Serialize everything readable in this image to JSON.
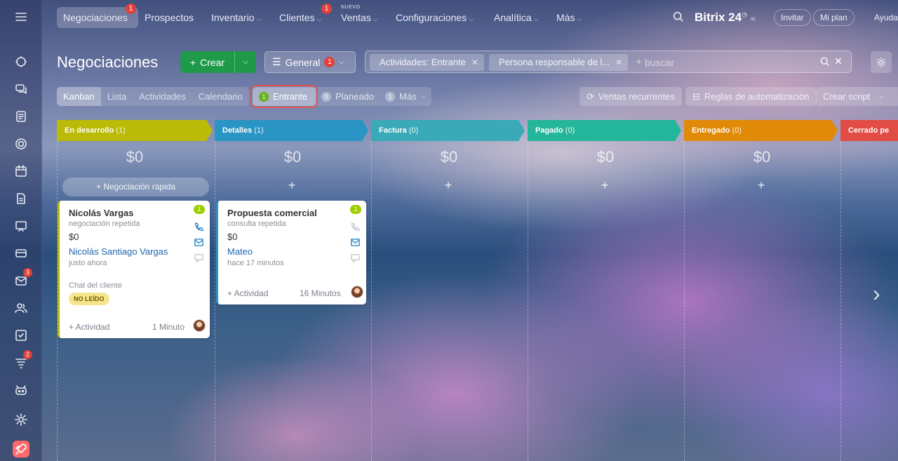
{
  "topnav": {
    "items": [
      {
        "label": "Negociaciones",
        "badge": "1"
      },
      {
        "label": "Prospectos"
      },
      {
        "label": "Inventario"
      },
      {
        "label": "Clientes",
        "badge": "1"
      },
      {
        "label": "Ventas",
        "tag": "NUEVO"
      },
      {
        "label": "Configuraciones"
      },
      {
        "label": "Analítica"
      },
      {
        "label": "Más"
      }
    ],
    "brand": "Bitrix 24",
    "invitar": "Invitar",
    "mi_plan": "Mi plan",
    "ayuda": "Ayuda"
  },
  "sidebar": {
    "badges": {
      "mail": "3",
      "funnel": "2"
    }
  },
  "page": {
    "title": "Negociaciones",
    "crear": "Crear",
    "general": "General",
    "general_badge": "1",
    "filters": [
      "Actividades: Entrante",
      "Persona responsable de l..."
    ],
    "search_placeholder": "buscar"
  },
  "views": {
    "tabs": [
      "Kanban",
      "Lista",
      "Actividades",
      "Calendario"
    ],
    "counters": {
      "entrante_count": "1",
      "entrante": "Entrante",
      "planeado_count": "0",
      "planeado": "Planeado",
      "mas_count": "1",
      "mas": "Más"
    },
    "ventas_recurrentes": "Ventas recurrentes",
    "reglas": "Reglas de automatización",
    "crear_script": "Crear script"
  },
  "stages": [
    {
      "name": "En desarrollo",
      "count": "(1)",
      "amount": "$0",
      "color": "#b9bb06"
    },
    {
      "name": "Detalles",
      "count": "(1)",
      "amount": "$0",
      "color": "#2a94c4"
    },
    {
      "name": "Factura",
      "count": "(0)",
      "amount": "$0",
      "color": "#3aaab9"
    },
    {
      "name": "Pagado",
      "count": "(0)",
      "amount": "$0",
      "color": "#24b69a"
    },
    {
      "name": "Entregado",
      "count": "(0)",
      "amount": "$0",
      "color": "#e08a08"
    },
    {
      "name": "Cerrado pe",
      "count": "",
      "amount": "",
      "color": "#e14d44"
    }
  ],
  "quick_deal": "Negociación rápida",
  "cards": [
    {
      "title": "Nicolás Vargas",
      "subtitle": "negociación repetida",
      "amount": "$0",
      "contact": "Nicolás Santiago Vargas",
      "time": "justo ahora",
      "chat": "Chat del cliente",
      "status": "NO LEÍDO",
      "badge": "1",
      "activity": "+ Actividad",
      "duration": "1 Minuto"
    },
    {
      "title": "Propuesta comercial",
      "subtitle": "consulta repetida",
      "amount": "$0",
      "contact": "Mateo",
      "time": "hace 17 minutos",
      "badge": "1",
      "activity": "+ Actividad",
      "duration": "16 Minutos"
    }
  ]
}
